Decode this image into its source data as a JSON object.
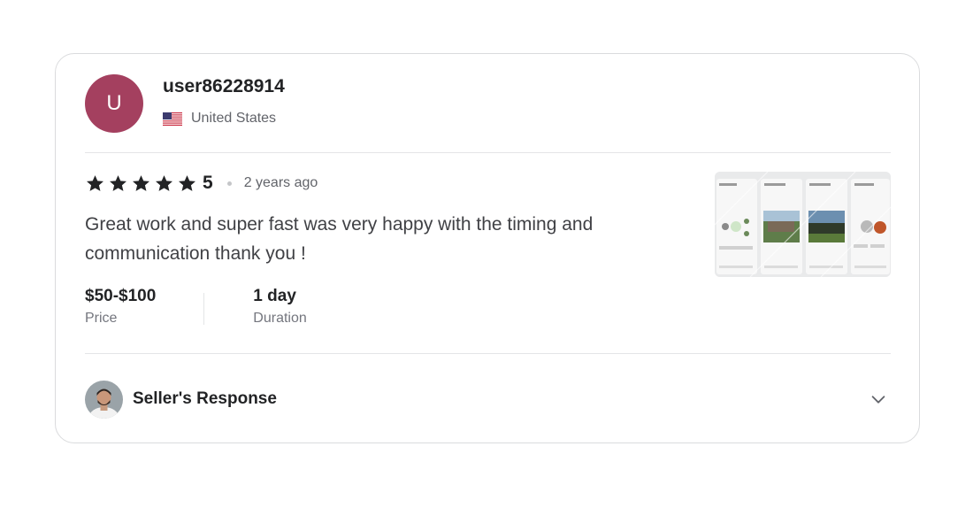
{
  "review": {
    "avatar_initial": "U",
    "username": "user86228914",
    "country": "United States",
    "flag_icon": "us-flag-icon",
    "rating": 5,
    "rating_label": "5",
    "time_ago": "2 years ago",
    "text": "Great work and super fast was very happy with the timing and communication thank you !",
    "price": {
      "value": "$50-$100",
      "label": "Price"
    },
    "duration": {
      "value": "1 day",
      "label": "Duration"
    },
    "seller_response_label": "Seller's Response",
    "colors": {
      "avatar_bg": "#a4405f",
      "star": "#222325",
      "text": "#404145",
      "muted": "#62646a"
    }
  }
}
